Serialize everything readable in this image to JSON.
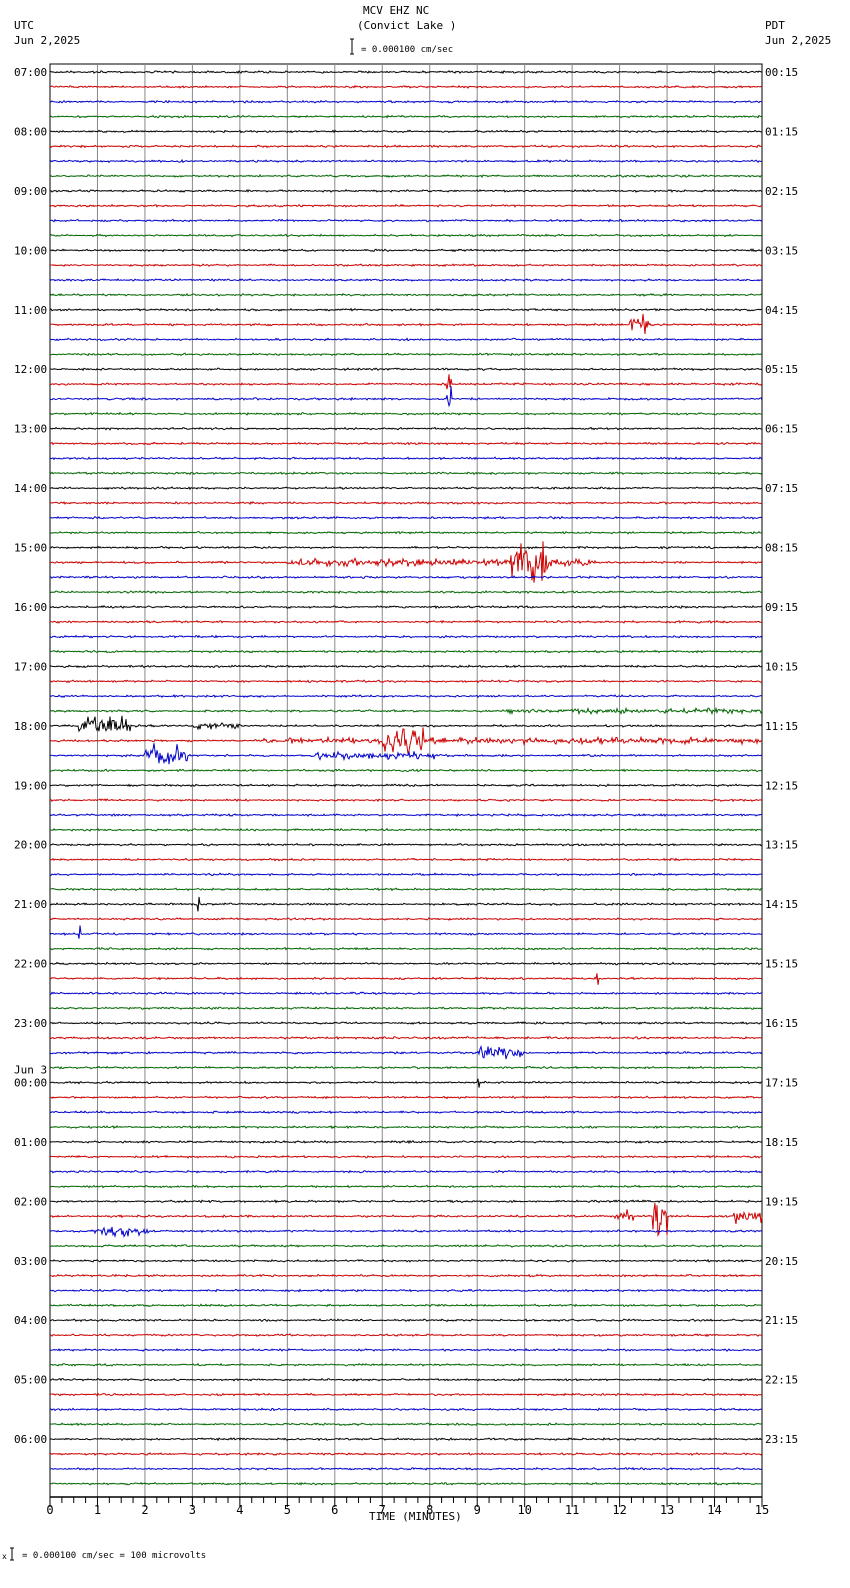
{
  "header": {
    "station": "MCV EHZ NC",
    "location": "(Convict Lake )",
    "left_tz": "UTC",
    "left_date": "Jun 2,2025",
    "right_tz": "PDT",
    "right_date": "Jun 2,2025",
    "scale": "= 0.000100 cm/sec"
  },
  "footer": {
    "scale": "= 0.000100 cm/sec =     100 microvolts"
  },
  "chart_data": {
    "type": "line",
    "title": "MCV EHZ NC (Convict Lake )",
    "xlabel": "TIME (MINUTES)",
    "xlim": [
      0,
      15
    ],
    "x_ticks": [
      "0",
      "1",
      "2",
      "3",
      "4",
      "5",
      "6",
      "7",
      "8",
      "9",
      "10",
      "11",
      "12",
      "13",
      "14",
      "15"
    ],
    "traces_per_hour": 4,
    "trace_colors": [
      "#000000",
      "#cc0000",
      "#0000cc",
      "#006600"
    ],
    "grid_color": "#888888",
    "left_labels": [
      "07:00",
      "08:00",
      "09:00",
      "10:00",
      "11:00",
      "12:00",
      "13:00",
      "14:00",
      "15:00",
      "16:00",
      "17:00",
      "18:00",
      "19:00",
      "20:00",
      "21:00",
      "22:00",
      "23:00",
      "00:00",
      "01:00",
      "02:00",
      "03:00",
      "04:00",
      "05:00",
      "06:00"
    ],
    "right_labels": [
      "00:15",
      "01:15",
      "02:15",
      "03:15",
      "04:15",
      "05:15",
      "06:15",
      "07:15",
      "08:15",
      "09:15",
      "10:15",
      "11:15",
      "12:15",
      "13:15",
      "14:15",
      "15:15",
      "16:15",
      "17:15",
      "18:15",
      "19:15",
      "20:15",
      "21:15",
      "22:15",
      "23:15"
    ],
    "date_change": {
      "label": "Jun 3",
      "before_hour_index": 17
    },
    "events": [
      {
        "trace": 17,
        "start": 12.2,
        "end": 12.6,
        "amp": 11
      },
      {
        "trace": 21,
        "start": 8.35,
        "end": 8.45,
        "amp": 28
      },
      {
        "trace": 22,
        "start": 8.35,
        "end": 8.45,
        "amp": 28
      },
      {
        "trace": 33,
        "start": 5.0,
        "end": 11.5,
        "amp": 3
      },
      {
        "trace": 33,
        "start": 9.7,
        "end": 10.5,
        "amp": 20
      },
      {
        "trace": 44,
        "start": 0.6,
        "end": 1.7,
        "amp": 9
      },
      {
        "trace": 44,
        "start": 3.0,
        "end": 4.0,
        "amp": 3
      },
      {
        "trace": 45,
        "start": 7.0,
        "end": 7.9,
        "amp": 10
      },
      {
        "trace": 45,
        "start": 4.5,
        "end": 15,
        "amp": 2.5
      },
      {
        "trace": 46,
        "start": 2.0,
        "end": 2.9,
        "amp": 9
      },
      {
        "trace": 46,
        "start": 5.5,
        "end": 8.1,
        "amp": 3
      },
      {
        "trace": 43,
        "start": 9.5,
        "end": 15,
        "amp": 2
      },
      {
        "trace": 56,
        "start": 3.1,
        "end": 3.15,
        "amp": 14
      },
      {
        "trace": 58,
        "start": 0.6,
        "end": 0.65,
        "amp": 14
      },
      {
        "trace": 61,
        "start": 11.5,
        "end": 11.55,
        "amp": 12
      },
      {
        "trace": 66,
        "start": 9.0,
        "end": 10.0,
        "amp": 5
      },
      {
        "trace": 68,
        "start": 9.0,
        "end": 9.05,
        "amp": 10
      },
      {
        "trace": 77,
        "start": 11.9,
        "end": 12.3,
        "amp": 6
      },
      {
        "trace": 77,
        "start": 12.7,
        "end": 13.0,
        "amp": 14
      },
      {
        "trace": 77,
        "start": 14.4,
        "end": 15,
        "amp": 6
      },
      {
        "trace": 78,
        "start": 0.9,
        "end": 2.1,
        "amp": 4
      }
    ]
  }
}
